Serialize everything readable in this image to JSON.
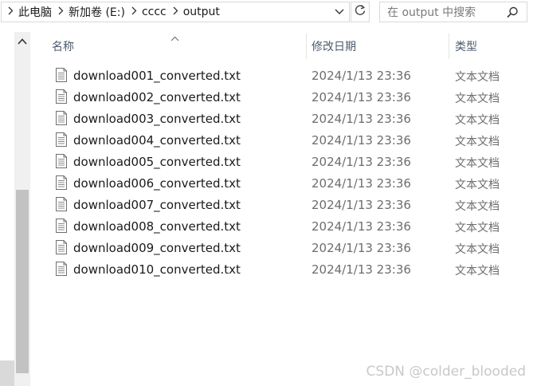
{
  "address_bar": {
    "breadcrumbs": [
      "此电脑",
      "新加卷 (E:)",
      "cccc",
      "output"
    ]
  },
  "search": {
    "placeholder": "在 output 中搜索"
  },
  "columns": {
    "name": "名称",
    "date_modified": "修改日期",
    "type": "类型"
  },
  "files": [
    {
      "name": "download001_converted.txt",
      "date": "2024/1/13 23:36",
      "type": "文本文档"
    },
    {
      "name": "download002_converted.txt",
      "date": "2024/1/13 23:36",
      "type": "文本文档"
    },
    {
      "name": "download003_converted.txt",
      "date": "2024/1/13 23:36",
      "type": "文本文档"
    },
    {
      "name": "download004_converted.txt",
      "date": "2024/1/13 23:36",
      "type": "文本文档"
    },
    {
      "name": "download005_converted.txt",
      "date": "2024/1/13 23:36",
      "type": "文本文档"
    },
    {
      "name": "download006_converted.txt",
      "date": "2024/1/13 23:36",
      "type": "文本文档"
    },
    {
      "name": "download007_converted.txt",
      "date": "2024/1/13 23:36",
      "type": "文本文档"
    },
    {
      "name": "download008_converted.txt",
      "date": "2024/1/13 23:36",
      "type": "文本文档"
    },
    {
      "name": "download009_converted.txt",
      "date": "2024/1/13 23:36",
      "type": "文本文档"
    },
    {
      "name": "download010_converted.txt",
      "date": "2024/1/13 23:36",
      "type": "文本文档"
    }
  ],
  "watermark": "CSDN @colder_blooded",
  "icons": {
    "breadcrumb_separator": "chevron-right-icon",
    "address_dropdown": "chevron-down-icon",
    "refresh": "refresh-icon",
    "search": "search-icon",
    "scroll_up": "chevron-up-icon",
    "sort_indicator": "sort-ascending-icon",
    "file": "text-file-icon"
  }
}
